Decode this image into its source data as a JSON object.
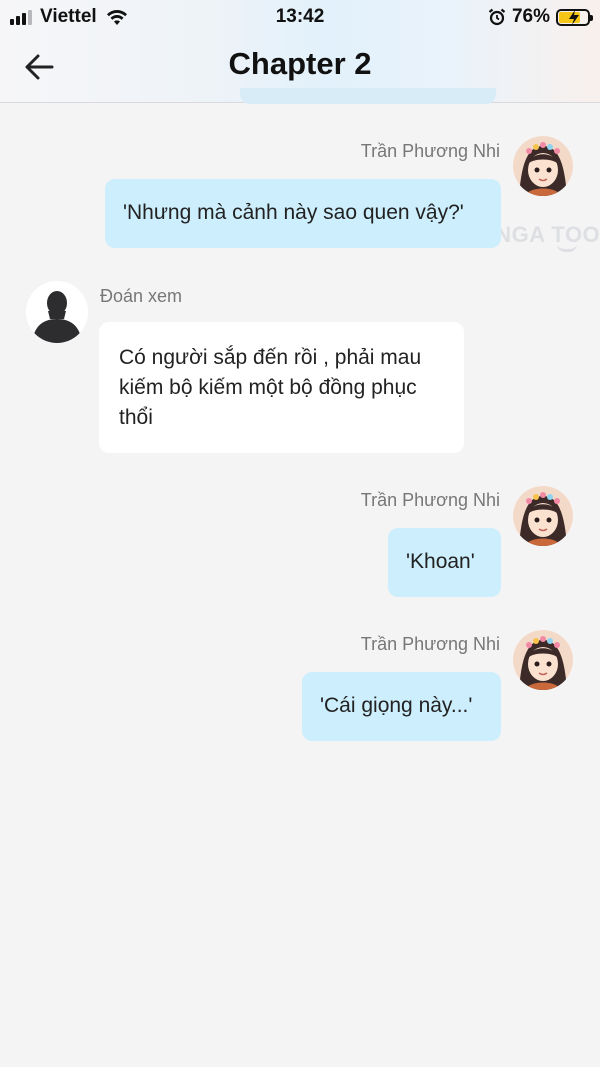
{
  "status_bar": {
    "carrier": "Viettel",
    "time": "13:42",
    "battery": "76%",
    "battery_level": 0.76
  },
  "header": {
    "title": "Chapter 2",
    "back_icon": "arrow-left-icon"
  },
  "watermark": "MANGA TOON",
  "messages": [
    {
      "sender": "Trần Phương Nhi",
      "text": "'Nhưng mà cảnh này sao quen vậy?'",
      "side": "right"
    },
    {
      "sender": "Đoán xem",
      "text": "Có người sắp đến rồi , phải mau kiếm bộ kiếm một bộ đồng phục thổi",
      "side": "left"
    },
    {
      "sender": "Trần Phương Nhi",
      "text": "'Khoan'",
      "side": "right"
    },
    {
      "sender": "Trần Phương Nhi",
      "text": "'Cái giọng này...'",
      "side": "right"
    }
  ],
  "colors": {
    "outgoing_bubble": "#cdeefc",
    "incoming_bubble": "#ffffff",
    "background": "#f4f4f5"
  }
}
